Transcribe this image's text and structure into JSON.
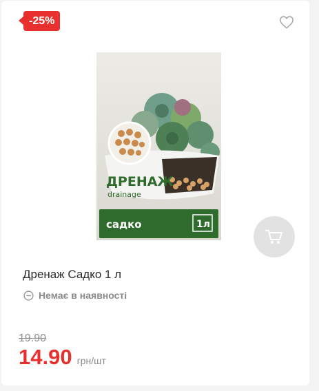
{
  "badge": {
    "discount": "-25%"
  },
  "icons": {
    "favorite": "heart-outline-icon",
    "cart": "cart-icon",
    "availability": "minus-circle-icon"
  },
  "product": {
    "title": "Дренаж Садко 1 л",
    "availability": "Немає в наявності",
    "old_price": "19.90",
    "price": "14.90",
    "unit": "грн/шт",
    "package": {
      "name": "ДРЕНАЖ",
      "subtitle": "drainage",
      "brand": "садко",
      "volume": "1л"
    }
  },
  "colors": {
    "accent": "#e8312f",
    "package_green": "#2f6b2c"
  }
}
